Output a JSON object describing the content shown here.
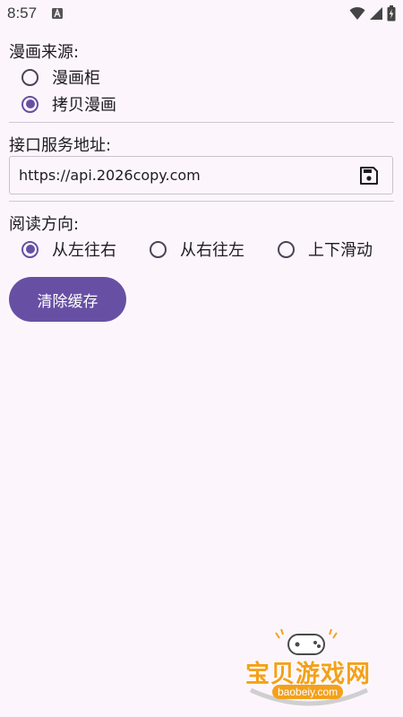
{
  "status_bar": {
    "time": "8:57"
  },
  "manga_source": {
    "label": "漫画来源:",
    "options": [
      {
        "label": "漫画柜",
        "selected": false
      },
      {
        "label": "拷贝漫画",
        "selected": true
      }
    ]
  },
  "api_address": {
    "label": "接口服务地址:",
    "value": "https://api.2026copy.com"
  },
  "reading_direction": {
    "label": "阅读方向:",
    "options": [
      {
        "label": "从左往右",
        "selected": true
      },
      {
        "label": "从右往左",
        "selected": false
      },
      {
        "label": "上下滑动",
        "selected": false
      }
    ]
  },
  "clear_cache_button": "清除缓存",
  "watermark": {
    "brand": "宝贝游戏网",
    "url": "baobeiy.com"
  },
  "colors": {
    "accent": "#6750a4",
    "background": "#fcf6fc",
    "watermark_orange": "#f3a11b"
  }
}
